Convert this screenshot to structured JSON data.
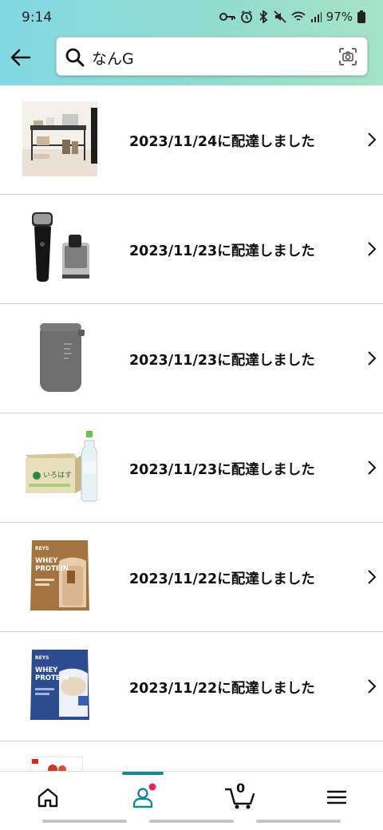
{
  "status_bar": {
    "time": "9:14",
    "battery": "97%"
  },
  "search": {
    "query": "なんG"
  },
  "orders": [
    {
      "label": "2023/11/24に配達しました",
      "thumb": "shelf-rack"
    },
    {
      "label": "2023/11/23に配達しました",
      "thumb": "electric-shaver"
    },
    {
      "label": "2023/11/23に配達しました",
      "thumb": "humidifier"
    },
    {
      "label": "2023/11/23に配達しました",
      "thumb": "water-case"
    },
    {
      "label": "2023/11/22に配達しました",
      "thumb": "whey-protein-cafe"
    },
    {
      "label": "2023/11/22に配達しました",
      "thumb": "whey-protein-milk-tea"
    }
  ],
  "product_text": {
    "brand": "REYS",
    "whey": "WHEY",
    "protein": "PROTEIN",
    "water": "いろはす"
  },
  "bottom_nav": {
    "cart_count": "0",
    "active_tab": "account"
  },
  "colors": {
    "header_gradient_start": "#82d8e3",
    "header_gradient_end": "#a6e3c6",
    "active_accent": "#168a94",
    "notification_dot": "#e0245e"
  }
}
